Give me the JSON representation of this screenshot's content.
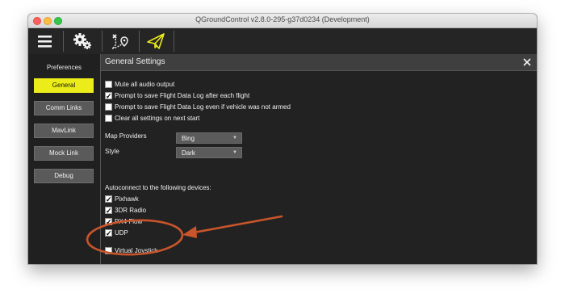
{
  "window": {
    "title": "QGroundControl v2.8.0-295-g37d0234 (Development)"
  },
  "toolbar": {
    "items": [
      {
        "icon": "hamburger-menu-icon"
      },
      {
        "icon": "gears-icon"
      },
      {
        "icon": "plan-route-icon"
      },
      {
        "icon": "paper-plane-icon"
      }
    ],
    "active_color": "#ecec1a"
  },
  "sidebar": {
    "heading": "Preferences",
    "items": [
      {
        "label": "General",
        "active": true
      },
      {
        "label": "Comm Links"
      },
      {
        "label": "MavLink"
      },
      {
        "label": "Mock Link"
      },
      {
        "label": "Debug"
      }
    ]
  },
  "general": {
    "title": "General Settings",
    "options": [
      {
        "label": "Mute all audio output",
        "checked": false
      },
      {
        "label": "Prompt to save Flight Data Log after each flight",
        "checked": true
      },
      {
        "label": "Prompt to save Flight Data Log even if vehicle was not armed",
        "checked": false
      },
      {
        "label": "Clear all settings on next start",
        "checked": false
      }
    ],
    "map_providers": {
      "label": "Map Providers",
      "value": "Bing"
    },
    "style": {
      "label": "Style",
      "value": "Dark"
    },
    "autoconnect": {
      "label": "Autoconnect to the following devices:",
      "devices": [
        {
          "label": "Pixhawk",
          "checked": true
        },
        {
          "label": "3DR Radio",
          "checked": true
        },
        {
          "label": "PX4 Flow",
          "checked": true
        },
        {
          "label": "UDP",
          "checked": true
        },
        {
          "label": "Virtual Joystick",
          "checked": false
        }
      ]
    }
  },
  "annotation": {
    "color": "#c8552b",
    "target": "Virtual Joystick"
  },
  "check_glyph": "✓"
}
